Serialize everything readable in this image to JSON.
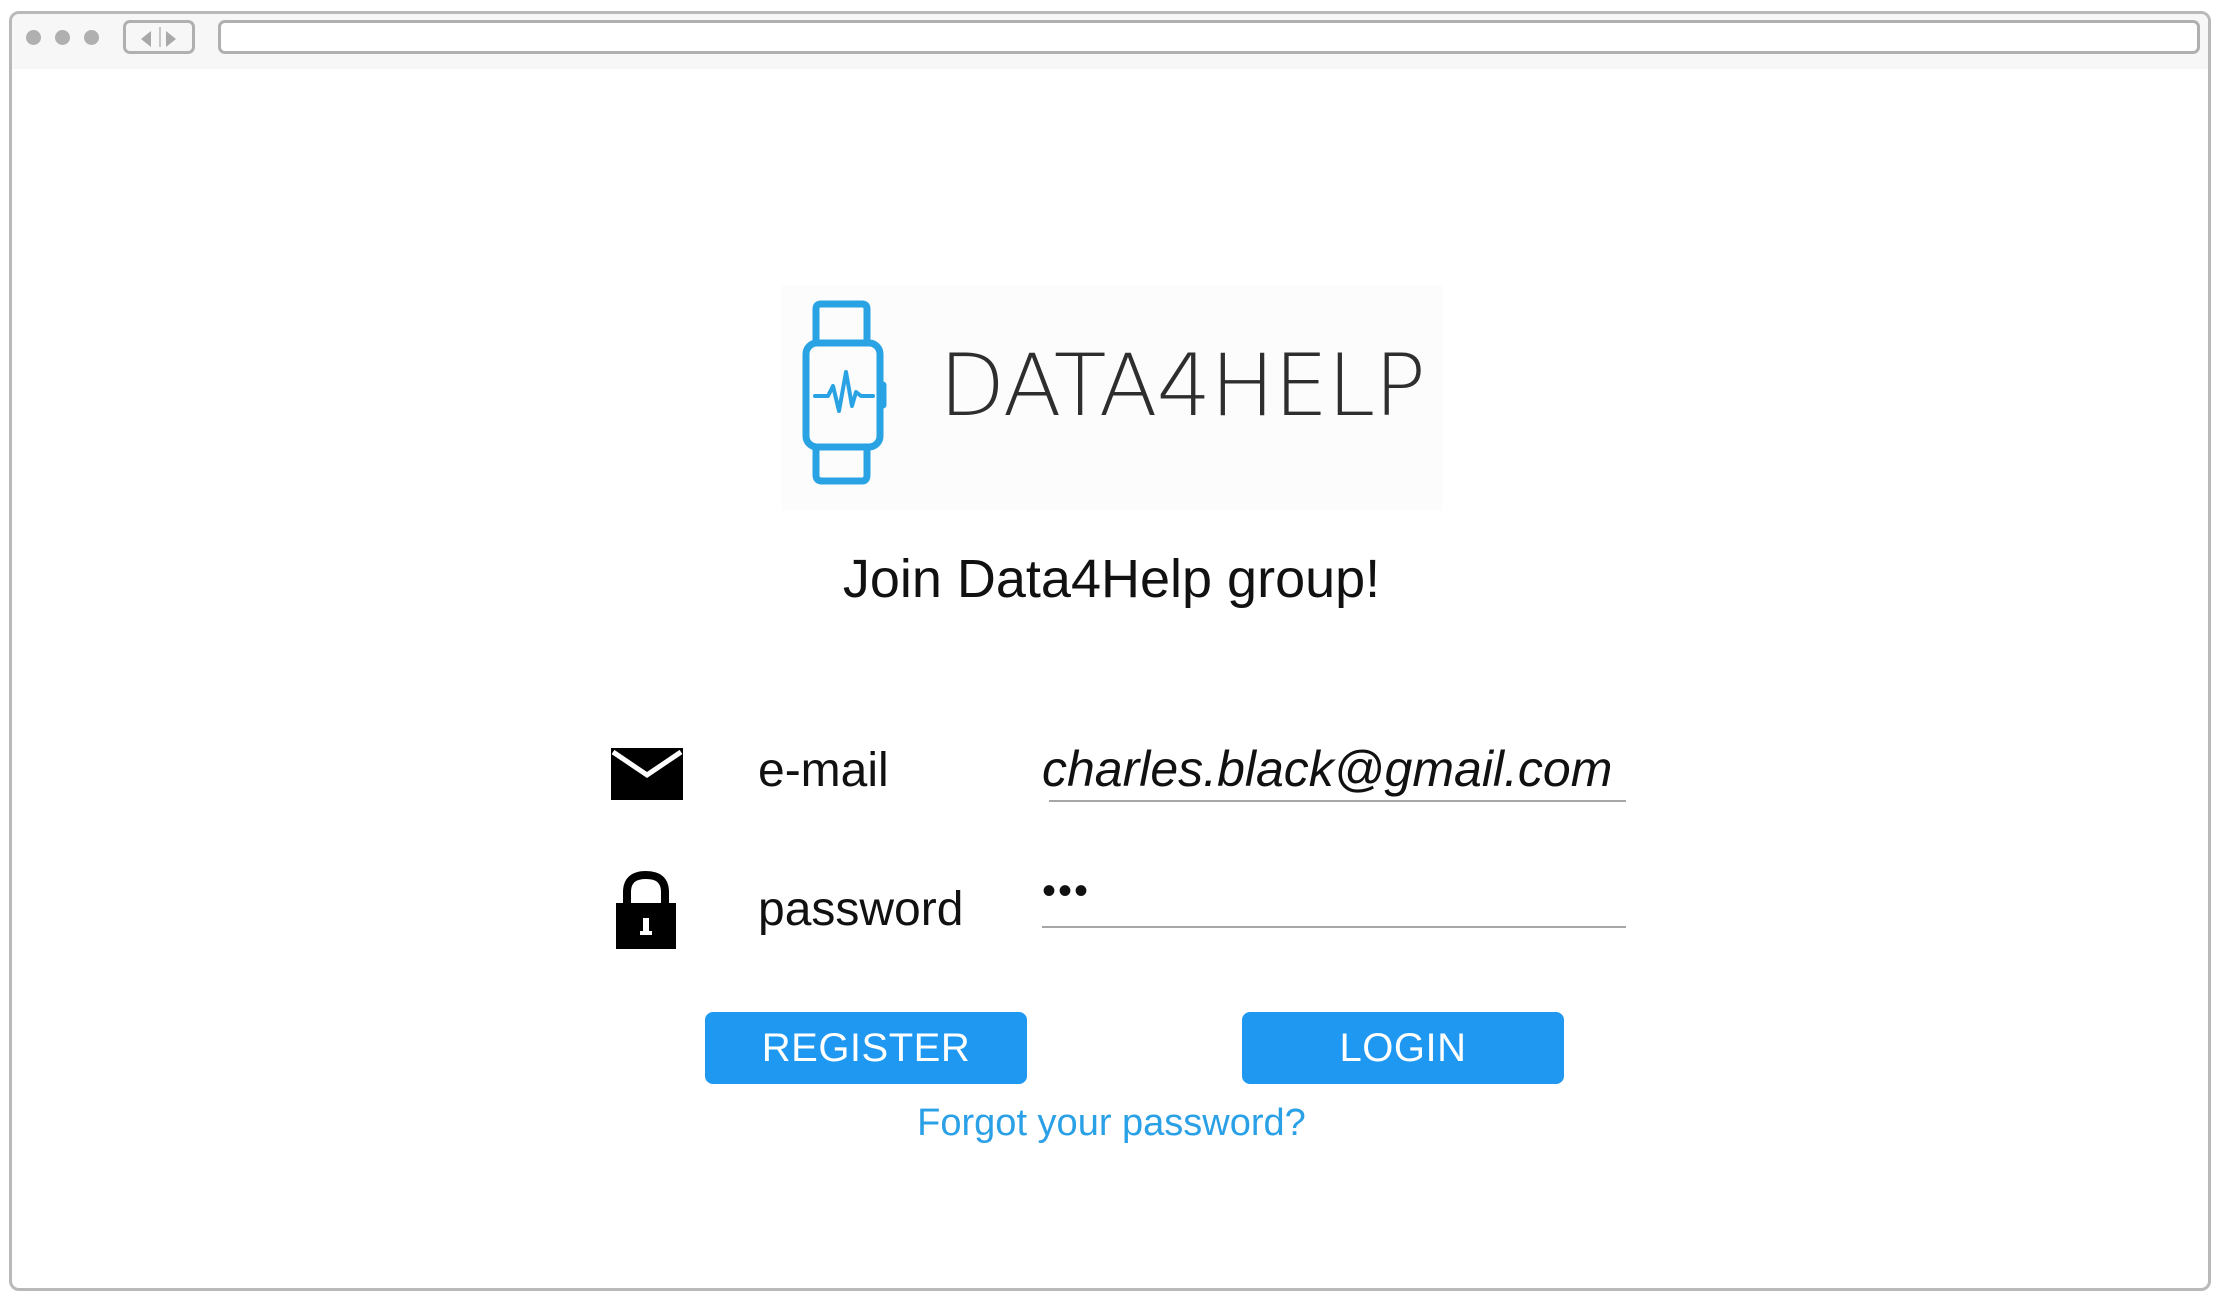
{
  "browser": {
    "url": ""
  },
  "logo": {
    "brand_text": "DATA4HELP",
    "accent_color": "#2aa3e4"
  },
  "page": {
    "headline": "Join Data4Help group!"
  },
  "form": {
    "email_label": "e-mail",
    "email_value": "charles.black@gmail.com",
    "email_icon": "envelope-icon",
    "password_label": "password",
    "password_value": "•••",
    "password_icon": "lock-icon"
  },
  "actions": {
    "register_label": "REGISTER",
    "login_label": "LOGIN",
    "forgot_link": "Forgot your password?",
    "button_color": "#1f98f2",
    "link_color": "#2aa0e6"
  }
}
